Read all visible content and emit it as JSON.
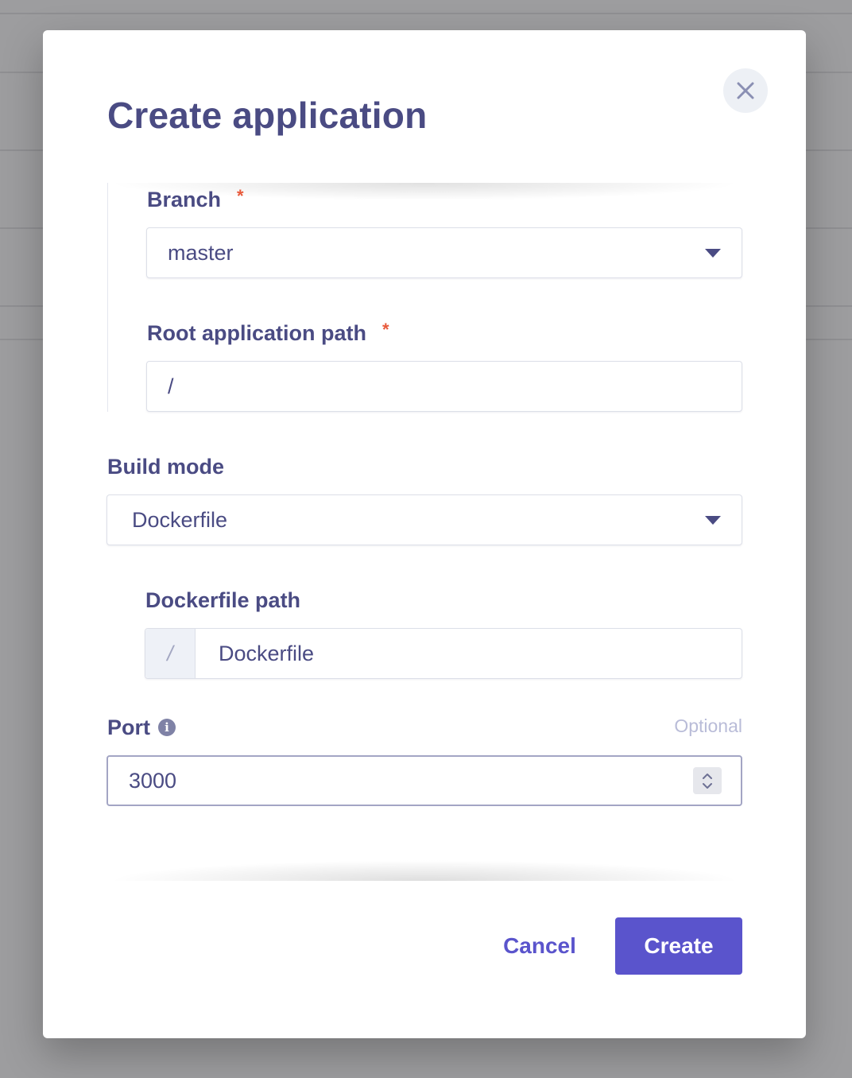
{
  "modal": {
    "title": "Create application"
  },
  "branch": {
    "label": "Branch",
    "required_mark": "*",
    "value": "master"
  },
  "root_path": {
    "label": "Root application path",
    "required_mark": "*",
    "value": "/"
  },
  "build_mode": {
    "label": "Build mode",
    "value": "Dockerfile"
  },
  "dockerfile_path": {
    "label": "Dockerfile path",
    "prefix": "/",
    "value": "Dockerfile"
  },
  "port": {
    "label": "Port",
    "info_icon": "info-icon",
    "optional_text": "Optional",
    "value": "3000"
  },
  "footer": {
    "cancel_label": "Cancel",
    "create_label": "Create"
  },
  "colors": {
    "primary": "#5a54cc",
    "text": "#4a4b83",
    "required": "#e8593a",
    "overlay": "#9d9d9f"
  }
}
